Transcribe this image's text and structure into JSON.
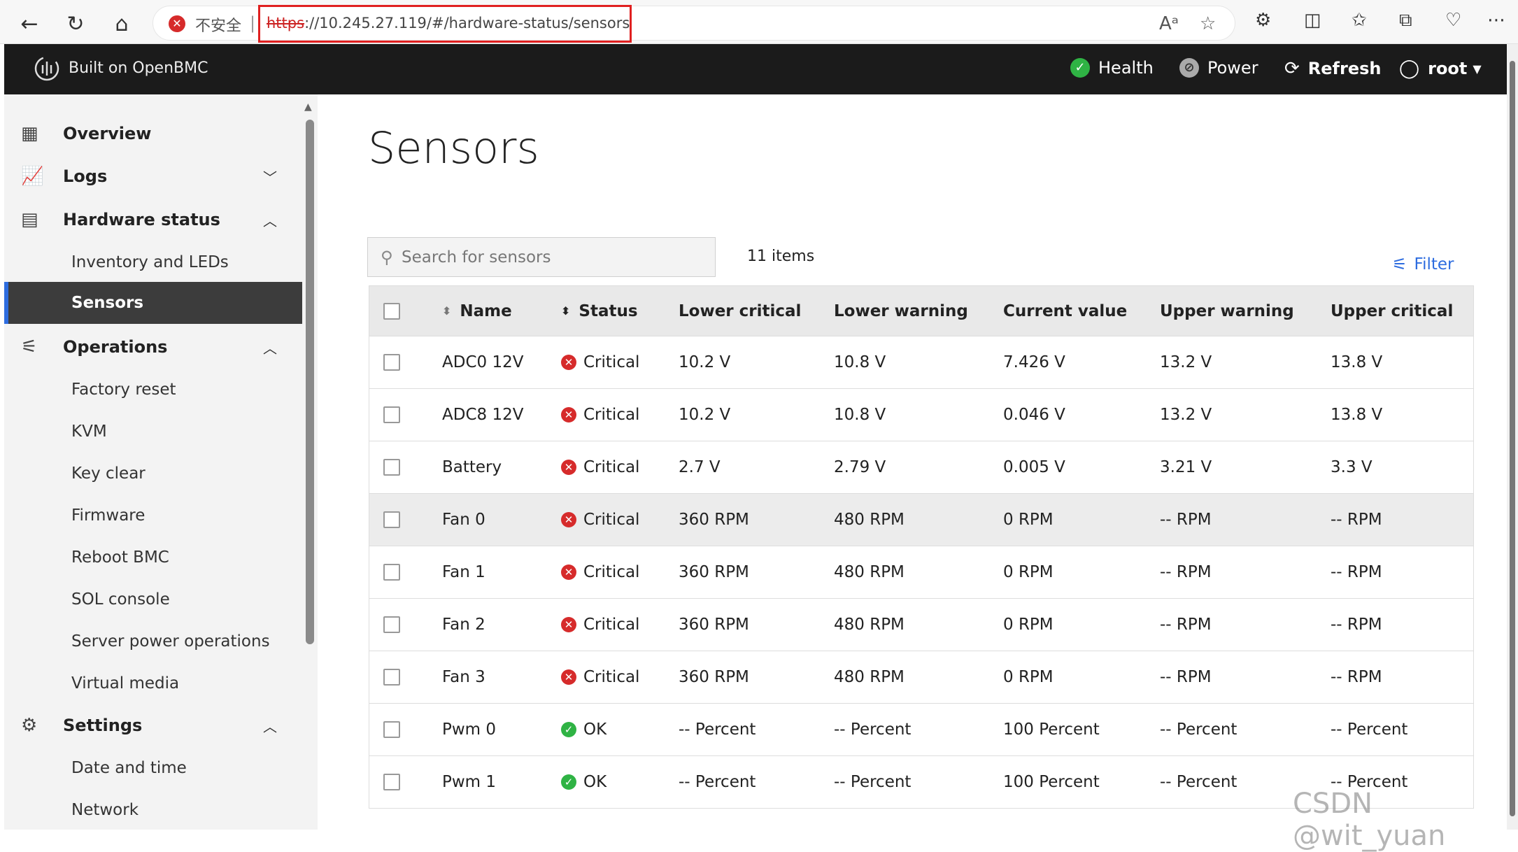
{
  "browser": {
    "insecure_label": "不安全",
    "url_protocol": "https",
    "url_rest": "://10.245.27.119/#/hardware-status/sensors"
  },
  "header": {
    "brand": "Built on OpenBMC",
    "health": "Health",
    "power": "Power",
    "refresh": "Refresh",
    "user": "root"
  },
  "sidebar": {
    "overview": "Overview",
    "logs": "Logs",
    "hardware_status": "Hardware status",
    "inventory": "Inventory and LEDs",
    "sensors": "Sensors",
    "operations": "Operations",
    "factory_reset": "Factory reset",
    "kvm": "KVM",
    "key_clear": "Key clear",
    "firmware": "Firmware",
    "reboot_bmc": "Reboot BMC",
    "sol_console": "SOL console",
    "server_power": "Server power operations",
    "virtual_media": "Virtual media",
    "settings": "Settings",
    "date_time": "Date and time",
    "network": "Network"
  },
  "main": {
    "title": "Sensors",
    "search_placeholder": "Search for sensors",
    "item_count": "11 items",
    "filter": "Filter"
  },
  "table": {
    "columns": [
      "Name",
      "Status",
      "Lower critical",
      "Lower warning",
      "Current value",
      "Upper warning",
      "Upper critical"
    ],
    "rows": [
      {
        "name": "ADC0 12V",
        "status": "Critical",
        "lc": "10.2 V",
        "lw": "10.8 V",
        "cur": "7.426 V",
        "uw": "13.2 V",
        "uc": "13.8 V"
      },
      {
        "name": "ADC8 12V",
        "status": "Critical",
        "lc": "10.2 V",
        "lw": "10.8 V",
        "cur": "0.046 V",
        "uw": "13.2 V",
        "uc": "13.8 V"
      },
      {
        "name": "Battery",
        "status": "Critical",
        "lc": "2.7 V",
        "lw": "2.79 V",
        "cur": "0.005 V",
        "uw": "3.21 V",
        "uc": "3.3 V"
      },
      {
        "name": "Fan 0",
        "status": "Critical",
        "lc": "360 RPM",
        "lw": "480 RPM",
        "cur": "0 RPM",
        "uw": "-- RPM",
        "uc": "-- RPM"
      },
      {
        "name": "Fan 1",
        "status": "Critical",
        "lc": "360 RPM",
        "lw": "480 RPM",
        "cur": "0 RPM",
        "uw": "-- RPM",
        "uc": "-- RPM"
      },
      {
        "name": "Fan 2",
        "status": "Critical",
        "lc": "360 RPM",
        "lw": "480 RPM",
        "cur": "0 RPM",
        "uw": "-- RPM",
        "uc": "-- RPM"
      },
      {
        "name": "Fan 3",
        "status": "Critical",
        "lc": "360 RPM",
        "lw": "480 RPM",
        "cur": "0 RPM",
        "uw": "-- RPM",
        "uc": "-- RPM"
      },
      {
        "name": "Pwm 0",
        "status": "OK",
        "lc": "-- Percent",
        "lw": "-- Percent",
        "cur": "100 Percent",
        "uw": "-- Percent",
        "uc": "-- Percent"
      },
      {
        "name": "Pwm 1",
        "status": "OK",
        "lc": "-- Percent",
        "lw": "-- Percent",
        "cur": "100 Percent",
        "uw": "-- Percent",
        "uc": "-- Percent"
      }
    ]
  },
  "watermark": "CSDN @wit_yuan",
  "colors": {
    "accent": "#2d6cdf",
    "critical": "#d62b2b",
    "ok": "#2fb344",
    "header_bg": "#1b1b1b"
  }
}
